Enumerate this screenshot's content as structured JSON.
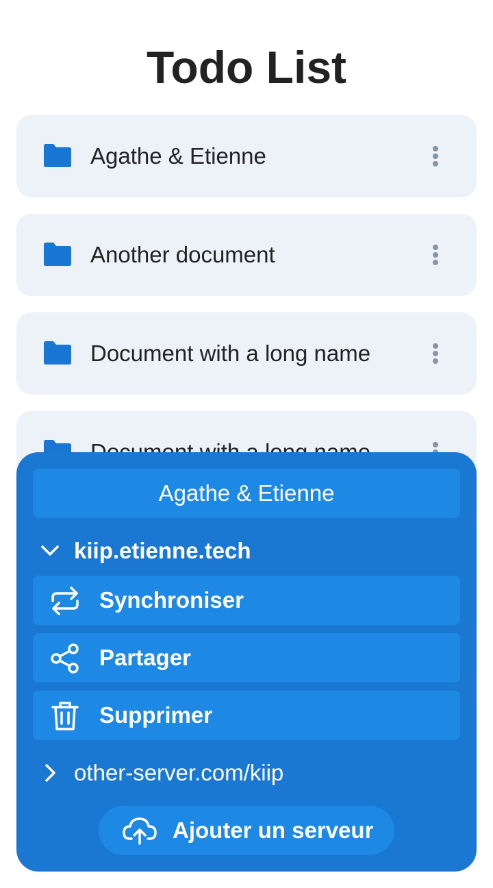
{
  "title": "Todo List",
  "documents": [
    {
      "name": "Agathe & Etienne"
    },
    {
      "name": "Another document"
    },
    {
      "name": "Document with a long name"
    },
    {
      "name": "Document with a long name"
    }
  ],
  "sheet": {
    "header": "Agathe & Etienne",
    "servers": [
      {
        "label": "kiip.etienne.tech",
        "expanded": true,
        "actions": [
          {
            "label": "Synchroniser",
            "icon": "sync-icon"
          },
          {
            "label": "Partager",
            "icon": "share-icon"
          },
          {
            "label": "Supprimer",
            "icon": "trash-icon"
          }
        ]
      },
      {
        "label": "other-server.com/kiip",
        "expanded": false
      }
    ],
    "add_server_label": "Ajouter un serveur"
  },
  "colors": {
    "accent": "#1a77d2",
    "accent_light": "#1e88e5",
    "folder": "#1976d2",
    "card_bg": "#ecf2f7",
    "menu_dots": "#8595a4"
  }
}
